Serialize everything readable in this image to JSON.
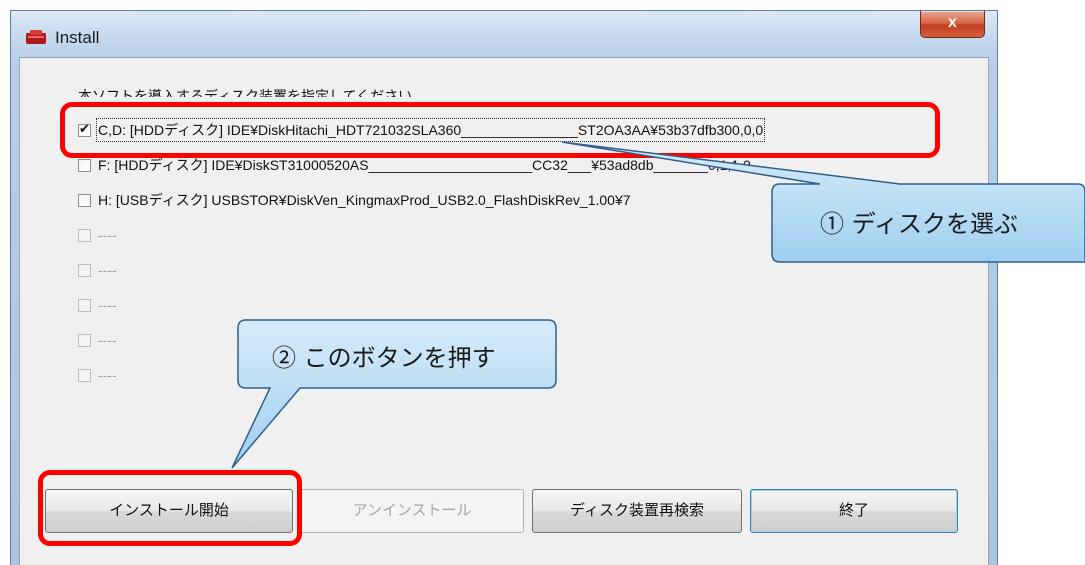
{
  "window": {
    "title": "Install",
    "close_label": "x"
  },
  "instruction": "本ソフトを導入するディスク装置を指定してください。",
  "disks": [
    {
      "checked": true,
      "enabled": true,
      "label": "C,D: [HDDディスク] IDE¥DiskHitachi_HDT721032SLA360_______________ST2OA3AA¥53b37dfb300,0,0"
    },
    {
      "checked": false,
      "enabled": true,
      "label": "F: [HDDディスク] IDE¥DiskST31000520AS_____________________CC32___¥53ad8db_______0,1,1,0"
    },
    {
      "checked": false,
      "enabled": true,
      "label": "H: [USBディスク] USBSTOR¥DiskVen_KingmaxProd_USB2.0_FlashDiskRev_1.00¥7"
    },
    {
      "checked": false,
      "enabled": false,
      "label": "----"
    },
    {
      "checked": false,
      "enabled": false,
      "label": "----"
    },
    {
      "checked": false,
      "enabled": false,
      "label": "----"
    },
    {
      "checked": false,
      "enabled": false,
      "label": "----"
    },
    {
      "checked": false,
      "enabled": false,
      "label": "----"
    }
  ],
  "buttons": {
    "install": "インストール開始",
    "uninstall": "アンインストール",
    "rescan": "ディスク装置再検索",
    "exit": "終了"
  },
  "callouts": {
    "select_disk": "① ディスクを選ぶ",
    "press_button": "② このボタンを押す"
  },
  "colors": {
    "highlight": "#ff0000",
    "callout_fill": "#b6dcf5",
    "title_bar": "#c6d9ee",
    "close_button": "#c23c1f"
  }
}
